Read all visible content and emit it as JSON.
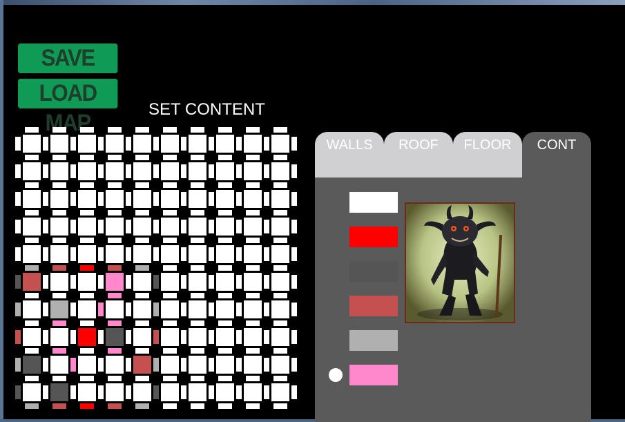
{
  "buttons": {
    "save_label": "SAVE MAP",
    "load_label": "LOAD MAP"
  },
  "grid_title": "SET CONTENT",
  "tabs": [
    {
      "label": "WALLS",
      "active": false
    },
    {
      "label": "ROOF",
      "active": false
    },
    {
      "label": "FLOOR",
      "active": false
    },
    {
      "label": "CONT",
      "active": true
    }
  ],
  "palette": [
    {
      "name": "white",
      "color": "#ffffff"
    },
    {
      "name": "red",
      "color": "#ff0000"
    },
    {
      "name": "dark-gray",
      "color": "#555555"
    },
    {
      "name": "brick",
      "color": "#c55050"
    },
    {
      "name": "light-gray",
      "color": "#b0b0b0"
    },
    {
      "name": "pink",
      "color": "#ff88cc"
    }
  ],
  "selected_palette_index": 5,
  "map": {
    "rows": 10,
    "cols": 10,
    "cells": [
      [
        "w",
        "w",
        "w",
        "w",
        "w",
        "w",
        "w",
        "w",
        "w",
        "w"
      ],
      [
        "w",
        "w",
        "w",
        "w",
        "w",
        "w",
        "w",
        "w",
        "w",
        "w"
      ],
      [
        "w",
        "w",
        "w",
        "w",
        "w",
        "w",
        "w",
        "w",
        "w",
        "w"
      ],
      [
        "w",
        "w",
        "w",
        "w",
        "w",
        "w",
        "w",
        "w",
        "w",
        "w"
      ],
      [
        "w",
        "w",
        "w",
        "w",
        "w",
        "w",
        "w",
        "w",
        "w",
        "w"
      ],
      [
        "b",
        "w",
        "w",
        "p",
        "w",
        "w",
        "w",
        "w",
        "w",
        "w"
      ],
      [
        "w",
        "l",
        "w",
        "w",
        "w",
        "w",
        "w",
        "w",
        "w",
        "w"
      ],
      [
        "w",
        "w",
        "r",
        "d",
        "w",
        "w",
        "w",
        "w",
        "w",
        "w"
      ],
      [
        "d",
        "w",
        "w",
        "w",
        "b",
        "w",
        "w",
        "w",
        "w",
        "w"
      ],
      [
        "w",
        "d",
        "w",
        "w",
        "w",
        "w",
        "w",
        "w",
        "w",
        "w"
      ]
    ],
    "hwalls": [
      [
        "w",
        "w",
        "w",
        "w",
        "w",
        "w",
        "w",
        "w",
        "w",
        "w"
      ],
      [
        "w",
        "w",
        "w",
        "w",
        "w",
        "w",
        "w",
        "w",
        "w",
        "w"
      ],
      [
        "w",
        "w",
        "w",
        "w",
        "w",
        "w",
        "w",
        "w",
        "w",
        "w"
      ],
      [
        "w",
        "w",
        "w",
        "w",
        "w",
        "w",
        "w",
        "w",
        "w",
        "w"
      ],
      [
        "w",
        "w",
        "w",
        "w",
        "w",
        "w",
        "w",
        "w",
        "w",
        "w"
      ],
      [
        "l",
        "b",
        "r",
        "b",
        "l",
        "w",
        "w",
        "w",
        "w",
        "w"
      ],
      [
        "w",
        "w",
        "w",
        "p",
        "w",
        "w",
        "w",
        "w",
        "w",
        "w"
      ],
      [
        "w",
        "p",
        "w",
        "p",
        "w",
        "w",
        "w",
        "w",
        "w",
        "w"
      ],
      [
        "w",
        "p",
        "w",
        "p",
        "w",
        "w",
        "w",
        "w",
        "w",
        "w"
      ],
      [
        "w",
        "w",
        "w",
        "w",
        "w",
        "w",
        "w",
        "w",
        "w",
        "w"
      ],
      [
        "l",
        "b",
        "r",
        "b",
        "l",
        "w",
        "w",
        "w",
        "w",
        "w"
      ]
    ],
    "vwalls": [
      [
        "w",
        "w",
        "w",
        "w",
        "w",
        "w",
        "w",
        "w",
        "w",
        "w",
        "w"
      ],
      [
        "w",
        "w",
        "w",
        "w",
        "w",
        "w",
        "w",
        "w",
        "w",
        "w",
        "w"
      ],
      [
        "w",
        "w",
        "w",
        "w",
        "w",
        "w",
        "w",
        "w",
        "w",
        "w",
        "w"
      ],
      [
        "w",
        "w",
        "w",
        "w",
        "w",
        "w",
        "w",
        "w",
        "w",
        "w",
        "w"
      ],
      [
        "w",
        "w",
        "w",
        "w",
        "w",
        "w",
        "w",
        "w",
        "w",
        "w",
        "w"
      ],
      [
        "d",
        "w",
        "w",
        "w",
        "w",
        "d",
        "w",
        "w",
        "w",
        "w",
        "w"
      ],
      [
        "l",
        "w",
        "w",
        "p",
        "w",
        "l",
        "w",
        "w",
        "w",
        "w",
        "w"
      ],
      [
        "b",
        "w",
        "w",
        "w",
        "w",
        "b",
        "w",
        "w",
        "w",
        "w",
        "w"
      ],
      [
        "l",
        "w",
        "p",
        "w",
        "w",
        "l",
        "w",
        "w",
        "w",
        "w",
        "w"
      ],
      [
        "d",
        "w",
        "w",
        "w",
        "w",
        "d",
        "w",
        "w",
        "w",
        "w",
        "w"
      ]
    ]
  },
  "colors": {
    "w": "#ffffff",
    "r": "#ff0000",
    "d": "#555555",
    "b": "#c55050",
    "l": "#b0b0b0",
    "p": "#ff88cc"
  }
}
